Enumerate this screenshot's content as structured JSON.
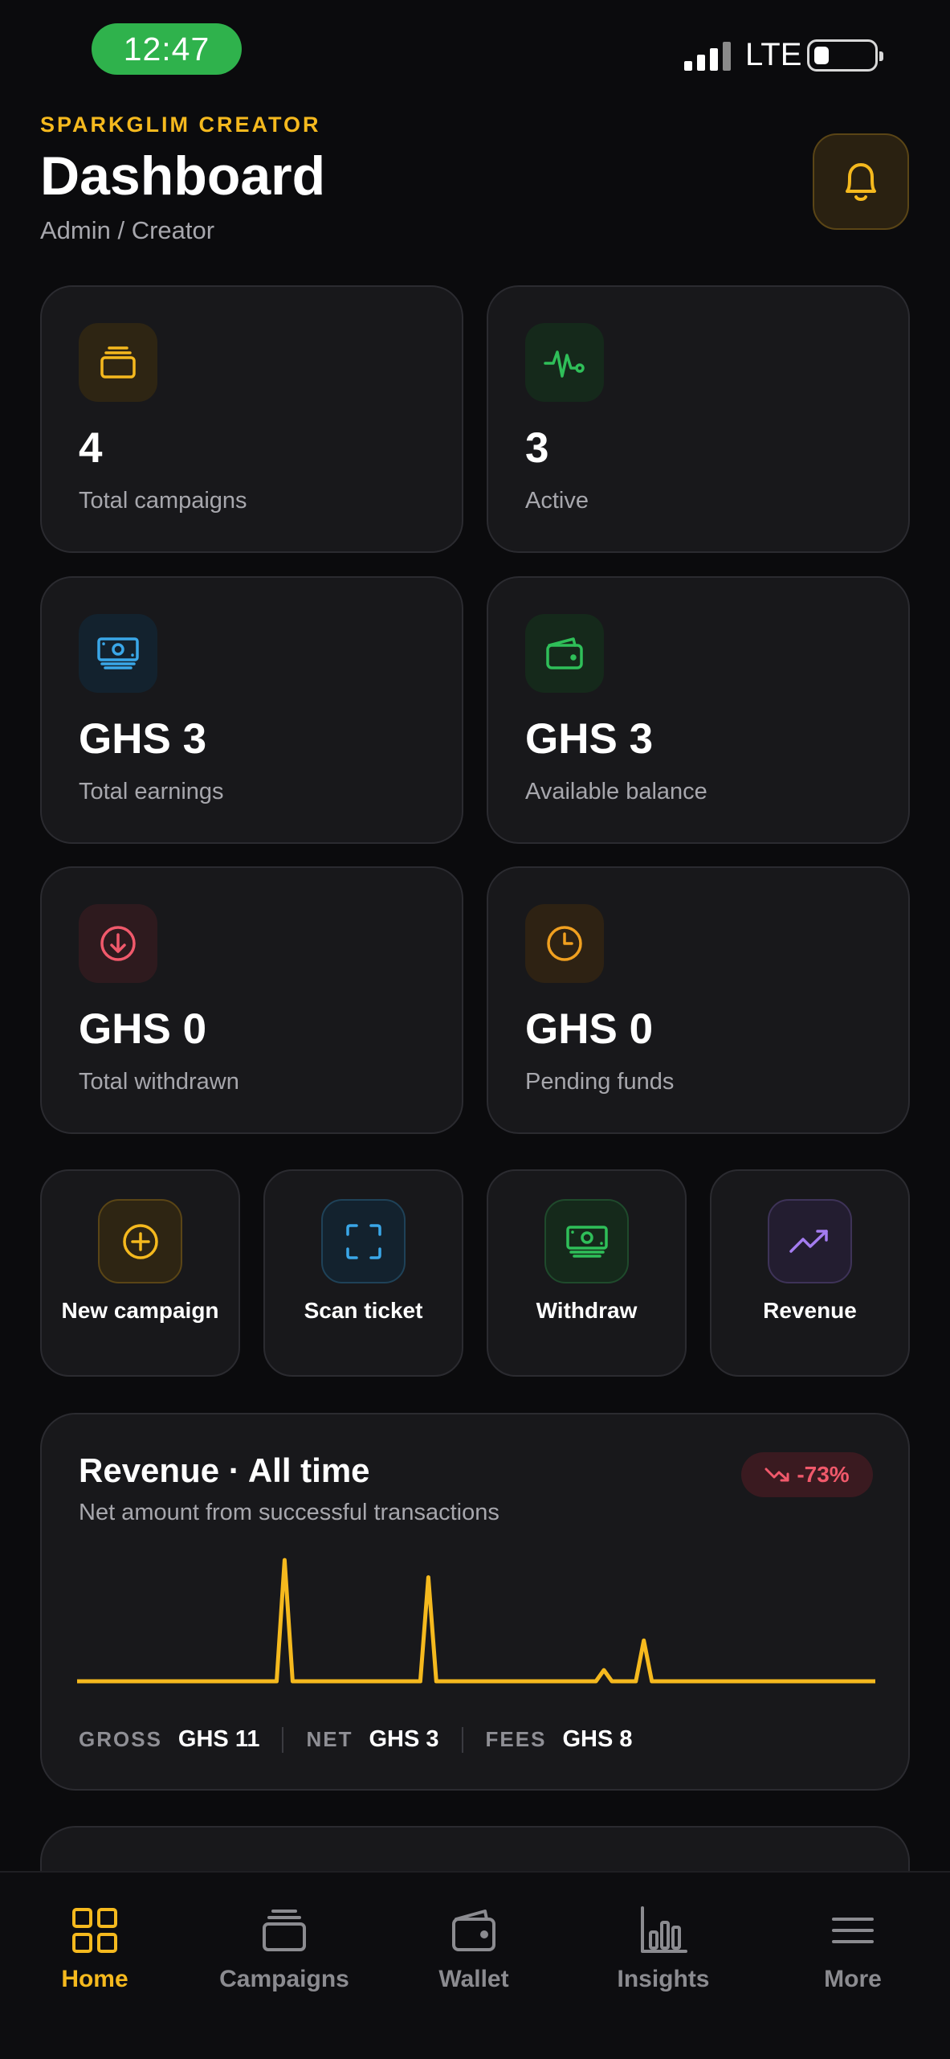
{
  "status": {
    "time": "12:47",
    "network": "LTE"
  },
  "header": {
    "eyebrow": "SPARKGLIM CREATOR",
    "title": "Dashboard",
    "breadcrumb": "Admin / Creator"
  },
  "stats": [
    {
      "value": "4",
      "label": "Total campaigns",
      "icon": "campaigns-stack-icon",
      "color": "#f5b91e"
    },
    {
      "value": "3",
      "label": "Active",
      "icon": "activity-pulse-icon",
      "color": "#2fbf59"
    },
    {
      "value": "GHS 3",
      "label": "Total earnings",
      "icon": "banknote-icon",
      "color": "#3aa7e8"
    },
    {
      "value": "GHS 3",
      "label": "Available balance",
      "icon": "wallet-icon",
      "color": "#2fbf59"
    },
    {
      "value": "GHS 0",
      "label": "Total withdrawn",
      "icon": "download-circle-icon",
      "color": "#f0596b"
    },
    {
      "value": "GHS 0",
      "label": "Pending funds",
      "icon": "clock-icon",
      "color": "#f0a020"
    }
  ],
  "quick_actions": [
    {
      "label": "New campaign",
      "icon": "plus-circle-icon"
    },
    {
      "label": "Scan ticket",
      "icon": "scan-frame-icon"
    },
    {
      "label": "Withdraw",
      "icon": "banknote-icon"
    },
    {
      "label": "Revenue",
      "icon": "trending-up-icon"
    }
  ],
  "revenue": {
    "title": "Revenue · All time",
    "subtitle": "Net amount from successful transactions",
    "change": "-73%",
    "gross_label": "GROSS",
    "gross_value": "GHS 11",
    "net_label": "NET",
    "net_value": "GHS 3",
    "fees_label": "FEES",
    "fees_value": "GHS 8"
  },
  "chart_data": {
    "type": "line",
    "title": "Revenue · All time",
    "series": [
      {
        "values": [
          0,
          0,
          0,
          0,
          0,
          0,
          0,
          0,
          0,
          0,
          0,
          0,
          0,
          0,
          0,
          0,
          0,
          0,
          0,
          0,
          0,
          0,
          0,
          0,
          0,
          0,
          0.98,
          0,
          0,
          0,
          0,
          0,
          0,
          0,
          0,
          0,
          0,
          0,
          0,
          0,
          0,
          0,
          0,
          0,
          0.84,
          0,
          0,
          0,
          0,
          0,
          0,
          0,
          0,
          0,
          0,
          0,
          0,
          0,
          0,
          0,
          0,
          0,
          0,
          0,
          0,
          0,
          0.09,
          0,
          0,
          0,
          0,
          0.33,
          0,
          0,
          0,
          0,
          0,
          0,
          0,
          0,
          0,
          0,
          0,
          0,
          0,
          0,
          0,
          0,
          0,
          0,
          0,
          0,
          0,
          0,
          0,
          0,
          0,
          0,
          0,
          0,
          0
        ]
      }
    ],
    "color": "#f5b91e",
    "grid": false,
    "legend": "none"
  },
  "tabs": [
    {
      "label": "Home",
      "icon": "home-grid-icon",
      "active": true
    },
    {
      "label": "Campaigns",
      "icon": "campaigns-stack-icon",
      "active": false
    },
    {
      "label": "Wallet",
      "icon": "wallet-icon",
      "active": false
    },
    {
      "label": "Insights",
      "icon": "bar-chart-icon",
      "active": false
    },
    {
      "label": "More",
      "icon": "menu-icon",
      "active": false
    }
  ]
}
